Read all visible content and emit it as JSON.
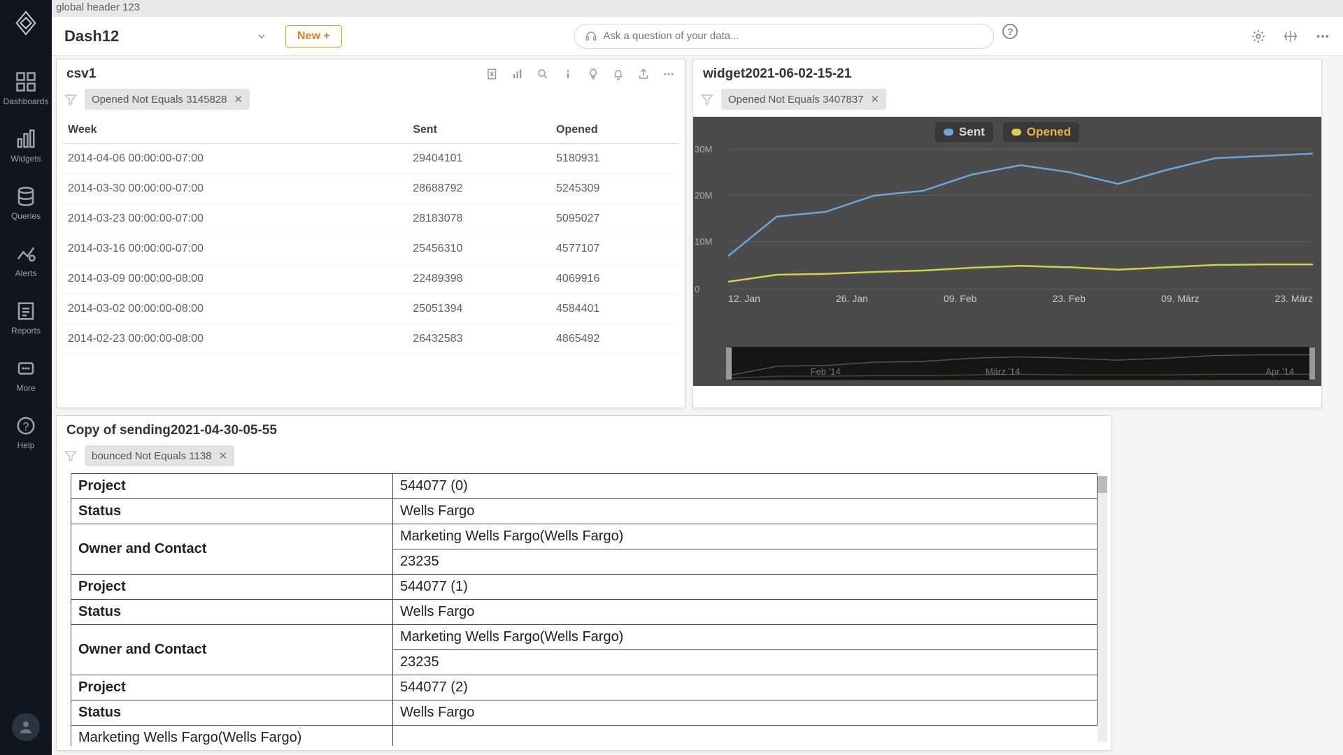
{
  "global_header": "global header 123",
  "left_rail": {
    "items": [
      {
        "label": "Dashboards",
        "icon": "grid-icon"
      },
      {
        "label": "Widgets",
        "icon": "bars-icon"
      },
      {
        "label": "Queries",
        "icon": "database-icon"
      },
      {
        "label": "Alerts",
        "icon": "alert-icon"
      },
      {
        "label": "Reports",
        "icon": "report-icon"
      },
      {
        "label": "More",
        "icon": "more-icon"
      }
    ],
    "help": "Help"
  },
  "toolbar": {
    "dashboard_name": "Dash12",
    "new_label": "New +",
    "ask_placeholder": "Ask a question of your data..."
  },
  "widget1": {
    "title": "csv1",
    "filter": "Opened Not Equals 3145828",
    "columns": [
      "Week",
      "Sent",
      "Opened"
    ],
    "rows": [
      [
        "2014-04-06 00:00:00-07:00",
        "29404101",
        "5180931"
      ],
      [
        "2014-03-30 00:00:00-07:00",
        "28688792",
        "5245309"
      ],
      [
        "2014-03-23 00:00:00-07:00",
        "28183078",
        "5095027"
      ],
      [
        "2014-03-16 00:00:00-07:00",
        "25456310",
        "4577107"
      ],
      [
        "2014-03-09 00:00:00-08:00",
        "22489398",
        "4069916"
      ],
      [
        "2014-03-02 00:00:00-08:00",
        "25051394",
        "4584401"
      ],
      [
        "2014-02-23 00:00:00-08:00",
        "26432583",
        "4865492"
      ]
    ]
  },
  "widget2": {
    "title": "widget2021-06-02-15-21",
    "filter": "Opened Not Equals 3407837",
    "legend": {
      "s1": "Sent",
      "s2": "Opened"
    },
    "colors": {
      "sent": "#6aa6d6",
      "opened": "#d4cf4e"
    },
    "yticks": [
      "30M",
      "20M",
      "10M",
      "0"
    ],
    "xticks": [
      "12. Jan",
      "26. Jan",
      "09. Feb",
      "23. Feb",
      "09. März",
      "23. März"
    ],
    "brush_labels": [
      "Feb '14",
      "März '14",
      "Apr '14"
    ]
  },
  "widget3": {
    "title": "Copy of sending2021-04-30-05-55",
    "filter": "bounced Not Equals 1138",
    "rows": [
      {
        "k": "Project",
        "v": "544077 (0)"
      },
      {
        "k": "Status",
        "v": "Wells Fargo"
      },
      {
        "k": "Owner and Contact",
        "v": "Marketing Wells Fargo(Wells Fargo)",
        "rowspan": 2
      },
      {
        "v": "23235"
      },
      {
        "k": "Project",
        "v": "544077 (1)"
      },
      {
        "k": "Status",
        "v": "Wells Fargo"
      },
      {
        "k": "Owner and Contact",
        "v": "Marketing Wells Fargo(Wells Fargo)",
        "rowspan": 2
      },
      {
        "v": "23235"
      },
      {
        "k": "Project",
        "v": "544077 (2)"
      },
      {
        "k": "Status",
        "v": "Wells Fargo"
      },
      {
        "v": "Marketing Wells Fargo(Wells Fargo)"
      }
    ]
  },
  "chart_data": {
    "type": "line",
    "title": "widget2021-06-02-15-21",
    "xlabel": "",
    "ylabel": "",
    "ylim": [
      0,
      30000000
    ],
    "x": [
      "12. Jan",
      "19. Jan",
      "26. Jan",
      "02. Feb",
      "09. Feb",
      "16. Feb",
      "23. Feb",
      "02. März",
      "09. März",
      "16. März",
      "23. März",
      "30. März",
      "06. Apr"
    ],
    "series": [
      {
        "name": "Sent",
        "color": "#6aa6d6",
        "values": [
          7000000,
          15500000,
          16500000,
          20000000,
          21000000,
          24500000,
          26500000,
          25000000,
          22500000,
          25500000,
          28000000,
          28500000,
          29000000
        ]
      },
      {
        "name": "Opened",
        "color": "#d4cf4e",
        "values": [
          1500000,
          3000000,
          3200000,
          3600000,
          3900000,
          4500000,
          4900000,
          4600000,
          4100000,
          4600000,
          5100000,
          5200000,
          5200000
        ]
      }
    ]
  }
}
